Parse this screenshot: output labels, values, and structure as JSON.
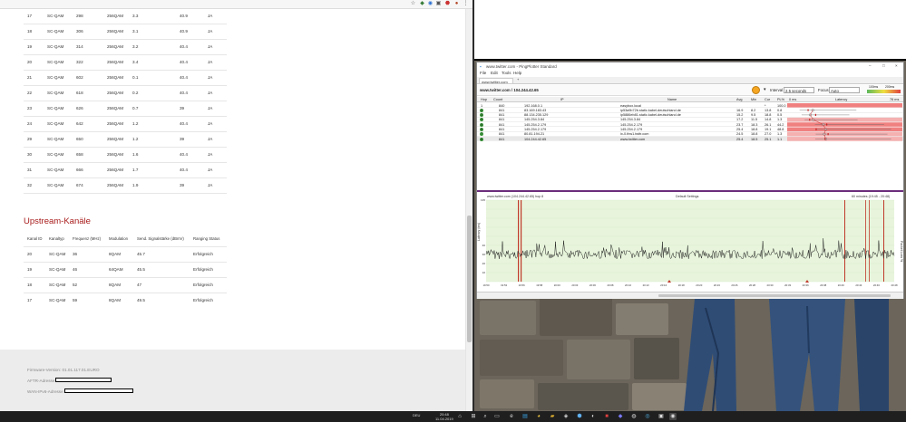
{
  "browser": {
    "extension_icons": [
      "star-icon",
      "shield-icon",
      "vpn-icon",
      "puzzle-icon",
      "abp-icon",
      "profile-icon",
      "menu-icon"
    ]
  },
  "downstream_rows": [
    {
      "id": "17",
      "type": "SC-QAM",
      "freq": "298",
      "mod": "256QAM",
      "power": "3.3",
      "snr": "40.9",
      "locked": "JA"
    },
    {
      "id": "18",
      "type": "SC-QAM",
      "freq": "306",
      "mod": "256QAM",
      "power": "3.1",
      "snr": "40.9",
      "locked": "JA"
    },
    {
      "id": "19",
      "type": "SC-QAM",
      "freq": "314",
      "mod": "256QAM",
      "power": "3.2",
      "snr": "40.4",
      "locked": "JA"
    },
    {
      "id": "20",
      "type": "SC-QAM",
      "freq": "322",
      "mod": "256QAM",
      "power": "3.4",
      "snr": "40.4",
      "locked": "JA"
    },
    {
      "id": "21",
      "type": "SC-QAM",
      "freq": "602",
      "mod": "256QAM",
      "power": "0.1",
      "snr": "40.4",
      "locked": "JA"
    },
    {
      "id": "22",
      "type": "SC-QAM",
      "freq": "618",
      "mod": "256QAM",
      "power": "0.2",
      "snr": "40.4",
      "locked": "JA"
    },
    {
      "id": "23",
      "type": "SC-QAM",
      "freq": "626",
      "mod": "256QAM",
      "power": "0.7",
      "snr": "39",
      "locked": "JA"
    },
    {
      "id": "24",
      "type": "SC-QAM",
      "freq": "642",
      "mod": "256QAM",
      "power": "1.2",
      "snr": "40.4",
      "locked": "JA"
    },
    {
      "id": "29",
      "type": "SC-QAM",
      "freq": "650",
      "mod": "256QAM",
      "power": "1.2",
      "snr": "39",
      "locked": "JA"
    },
    {
      "id": "30",
      "type": "SC-QAM",
      "freq": "658",
      "mod": "256QAM",
      "power": "1.6",
      "snr": "40.4",
      "locked": "JA"
    },
    {
      "id": "31",
      "type": "SC-QAM",
      "freq": "666",
      "mod": "256QAM",
      "power": "1.7",
      "snr": "40.4",
      "locked": "JA"
    },
    {
      "id": "32",
      "type": "SC-QAM",
      "freq": "674",
      "mod": "256QAM",
      "power": "1.9",
      "snr": "39",
      "locked": "JA"
    }
  ],
  "upstream": {
    "title": "Upstream-Kanäle",
    "headers": [
      "Kanal ID",
      "Kanaltyp",
      "Frequenz (MHz)",
      "Modulation",
      "Send. Signalstärke (dBmV)",
      "Ranging Status"
    ],
    "rows": [
      {
        "id": "20",
        "type": "SC-QAM",
        "freq": "36",
        "mod": "8QAM",
        "power": "45.7",
        "status": "Erfolgreich"
      },
      {
        "id": "19",
        "type": "SC-QAM",
        "freq": "46",
        "mod": "64QAM",
        "power": "45.5",
        "status": "Erfolgreich"
      },
      {
        "id": "18",
        "type": "SC-QAM",
        "freq": "52",
        "mod": "8QAM",
        "power": "47",
        "status": "Erfolgreich"
      },
      {
        "id": "17",
        "type": "SC-QAM",
        "freq": "59",
        "mod": "8QAM",
        "power": "49.5",
        "status": "Erfolgreich"
      }
    ]
  },
  "footer": {
    "firmware": "Firmware-Version: 01.01.117.01.EURO",
    "aftr": "AFTR-Adresse:",
    "wan_ipv6": "WAN-IPv6-Adresse:"
  },
  "pingplotter": {
    "window_title": "www.twitter.com - PingPlotter Standard",
    "menu": [
      "File",
      "Edit",
      "Tools",
      "Help"
    ],
    "tab": "www.twitter.com",
    "target": "www.twitter.com / 104.244.42.65",
    "interval_label": "Interval",
    "interval_value": "2.5 seconds",
    "focus_label": "Focus",
    "focus_value": "Auto",
    "legend": [
      "100ms",
      "200ms"
    ],
    "table_headers": {
      "hop": "Hop",
      "count": "Count",
      "ip": "IP",
      "name": "Name",
      "avg": "Avg",
      "min": "Min",
      "cur": "Cur",
      "pl": "PL%",
      "zero": "0 ms",
      "latency": "Latency",
      "max": "76 ms"
    },
    "hops": [
      {
        "hop": "1",
        "count": "840",
        "ip": "192.168.0.1",
        "name": "easybox.local",
        "avg": "",
        "min": "",
        "cur": "*",
        "pl": "100.0"
      },
      {
        "hop": "2",
        "count": "841",
        "ip": "83.169.183.43",
        "name": "ip53a9b72b.static.kabel-deutschland.de",
        "avg": "16.9",
        "min": "8.2",
        "cur": "13.8",
        "pl": "0.8"
      },
      {
        "hop": "3",
        "count": "841",
        "ip": "88.134.235.129",
        "name": "ip5886eb81.static.kabel-deutschland.de",
        "avg": "15.2",
        "min": "9.5",
        "cur": "18.8",
        "pl": "0.5"
      },
      {
        "hop": "4",
        "count": "841",
        "ip": "145.254.3.84",
        "name": "145.254.3.84",
        "avg": "17.2",
        "min": "11.5",
        "cur": "14.8",
        "pl": "1.3"
      },
      {
        "hop": "5",
        "count": "841",
        "ip": "145.254.2.179",
        "name": "145.254.2.179",
        "avg": "23.7",
        "min": "18.3",
        "cur": "26.1",
        "pl": "44.2"
      },
      {
        "hop": "6",
        "count": "841",
        "ip": "145.254.2.179",
        "name": "145.254.2.179",
        "avg": "25.4",
        "min": "18.8",
        "cur": "19.1",
        "pl": "48.8"
      },
      {
        "hop": "7",
        "count": "841",
        "ip": "80.81.194.21",
        "name": "ix-0.thw1.twttr.com",
        "avg": "24.5",
        "min": "18.8",
        "cur": "27.0",
        "pl": "1.3"
      },
      {
        "hop": "8",
        "count": "841",
        "ip": "104.244.42.65",
        "name": "www.twitter.com",
        "avg": "25.4",
        "min": "18.5",
        "cur": "25.1",
        "pl": "1.1"
      }
    ],
    "summary": {
      "count": "841",
      "label": "Round Trip (ms)",
      "avg": "25.4",
      "min": "18.5",
      "cur": "25.1",
      "pl": "1.1",
      "focus": "Focus: 19:45 - 20:48"
    },
    "graph_title_left": "www.twitter.com (104.244.42.65) hop 8",
    "graph_title_center": "Default Settings",
    "graph_title_right": "60 minutes (19:45 - 20:48)",
    "y_ticks": [
      "135",
      "",
      "",
      "",
      "",
      "40",
      "30",
      "20",
      "10",
      ""
    ],
    "y_label": "Latency (ms)",
    "y2_label": "Packet Loss %",
    "x_ticks": [
      "19:50",
      "19:53",
      "19:56",
      "19:58",
      "20:00",
      "20:03",
      "20:06",
      "20:08",
      "20:10",
      "20:13",
      "20:16",
      "20:18",
      "20:20",
      "20:23",
      "20:26",
      "20:28",
      "20:30",
      "20:33",
      "20:36",
      "20:38",
      "20:40",
      "20:43",
      "20:46",
      "20:48"
    ]
  },
  "taskbar": {
    "lang": "DEU",
    "time": "20:48",
    "date": "11.04.2019"
  }
}
